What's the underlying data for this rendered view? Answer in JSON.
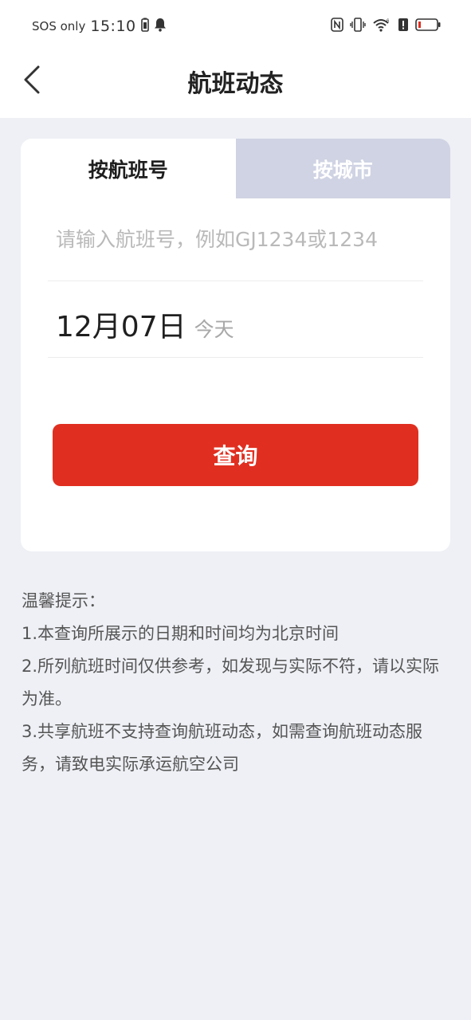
{
  "status_bar": {
    "sos": "SOS only",
    "time": "15:10",
    "icons": [
      "battery-saver-icon",
      "notification-bell-icon",
      "nfc-icon",
      "vibrate-icon",
      "wifi-icon",
      "alert-icon",
      "battery-icon"
    ]
  },
  "header": {
    "title": "航班动态",
    "back_icon": "chevron-left-icon"
  },
  "tabs": [
    {
      "label": "按航班号",
      "active": true
    },
    {
      "label": "按城市",
      "active": false
    }
  ],
  "form": {
    "flight_placeholder": "请输入航班号，例如GJ1234或1234",
    "flight_value": "",
    "date": "12月07日",
    "date_hint": "今天",
    "query_label": "查询"
  },
  "tips": {
    "title": "温馨提示：",
    "items": [
      "1.本查询所展示的日期和时间均为北京时间",
      "2.所列航班时间仅供参考，如发现与实际不符，请以实际为准。",
      "3.共享航班不支持查询航班动态，如需查询航班动态服务，请致电实际承运航空公司"
    ]
  },
  "colors": {
    "accent": "#e02f20",
    "background": "#eef0f5",
    "inactive_tab": "#cfd3e3"
  }
}
